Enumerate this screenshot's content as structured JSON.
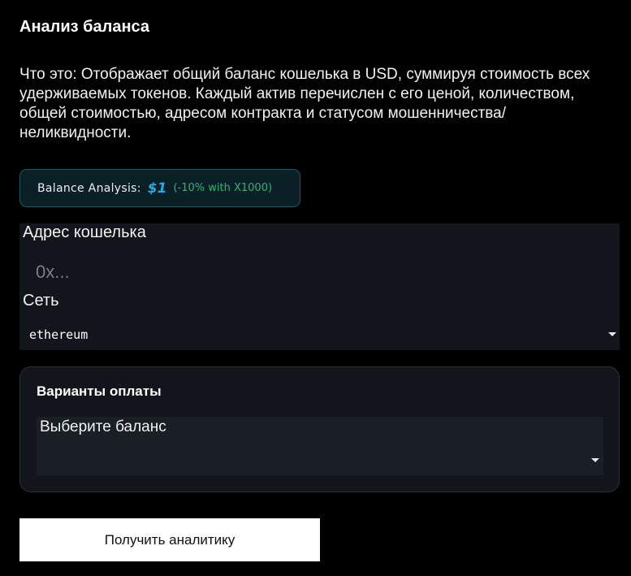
{
  "header": {
    "title": "Анализ баланса",
    "description": "Что это: Отображает общий баланс кошелька в USD, суммируя стоимость всех удерживаемых токенов. Каждый актив перечислен с его ценой, количеством, общей стоимостью, адресом контракта и статусом мошенничества/неликвидности."
  },
  "badge": {
    "label": "Balance Analysis:",
    "price": "$1",
    "note": "(-10% with X1000)",
    "colors": {
      "price": "#2aa8e0",
      "note": "#2bb673",
      "border": "#1e5a63"
    }
  },
  "form": {
    "wallet_label": "Адрес кошелька",
    "wallet_placeholder": "0x...",
    "wallet_value": "",
    "network_label": "Сеть",
    "network_value": "ethereum"
  },
  "payment": {
    "title": "Варианты оплаты",
    "select_label": "Выберите баланс",
    "select_value": ""
  },
  "actions": {
    "submit_label": "Получить аналитику"
  }
}
